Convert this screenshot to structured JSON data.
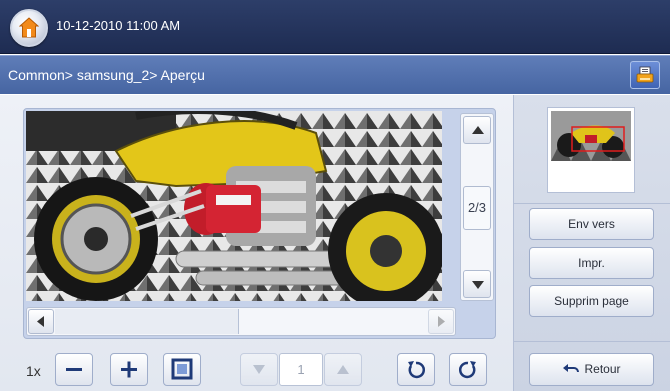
{
  "status_bar": {
    "datetime": "10-12-2010 11:00 AM",
    "home_icon": "home-icon"
  },
  "breadcrumb": {
    "text": "Common> samsung_2> Aperçu",
    "action_icon": "job-status-icon"
  },
  "viewer": {
    "page_indicator": "2/3",
    "current_page": "1",
    "zoom_label": "1x",
    "horizontal_scroll_position": 0.45
  },
  "controls": {
    "zoom_out_icon": "minus-icon",
    "zoom_in_icon": "plus-icon",
    "fit_icon": "fit-screen-icon",
    "rotate_left_icon": "rotate-left-icon",
    "rotate_right_icon": "rotate-right-icon"
  },
  "side_panel": {
    "send_label": "Env vers",
    "print_label": "Impr.",
    "delete_label": "Supprim page",
    "back_label": "Retour"
  },
  "colors": {
    "top_bar": "#1e2c52",
    "breadcrumb_bar": "#4665a2",
    "accent": "#3f63b4",
    "highlight": "#e01d1d"
  }
}
